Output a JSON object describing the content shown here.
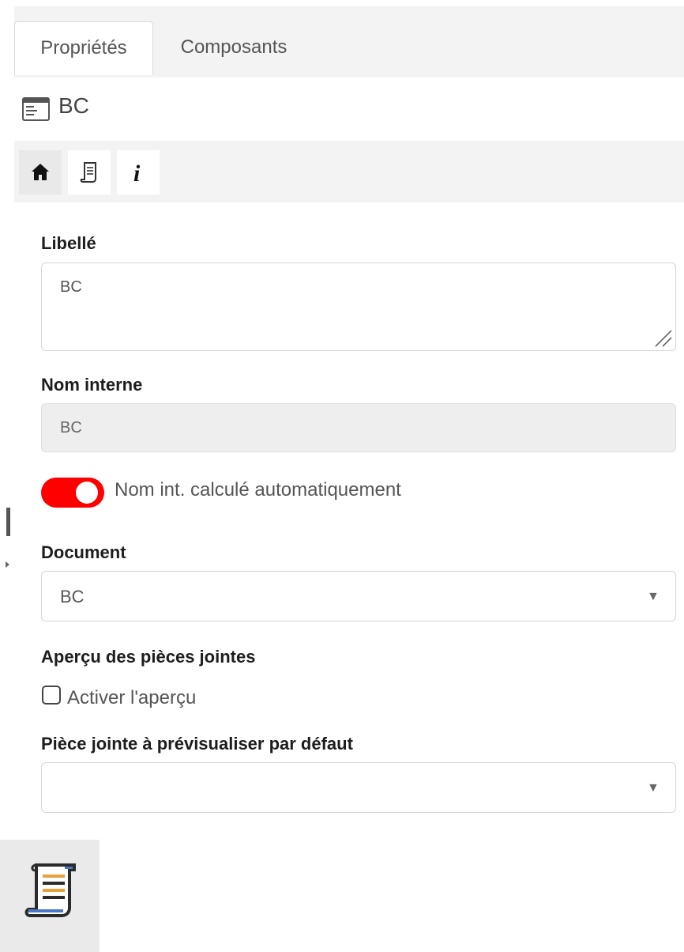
{
  "tabs": [
    {
      "label": "Propriétés",
      "active": true
    },
    {
      "label": "Composants",
      "active": false
    }
  ],
  "element": {
    "title": "BC",
    "icon": "form-window-icon"
  },
  "toolbar": {
    "buttons": [
      {
        "name": "home-icon",
        "active": true
      },
      {
        "name": "document-scroll-icon",
        "active": false
      },
      {
        "name": "info-icon",
        "active": false
      }
    ]
  },
  "form": {
    "libelle": {
      "label": "Libellé",
      "value": "BC"
    },
    "nom_interne": {
      "label": "Nom interne",
      "value": "BC"
    },
    "auto_name_toggle": {
      "label": "Nom int. calculé automatiquement",
      "checked": true,
      "color": "#ff0000"
    },
    "document": {
      "label": "Document",
      "value": "BC"
    },
    "apercu": {
      "label": "Aperçu des pièces jointes",
      "checkbox_label": "Activer l'aperçu",
      "checked": false
    },
    "piece_jointe": {
      "label": "Pièce jointe à prévisualiser par défaut",
      "value": ""
    }
  },
  "bottom_tile": {
    "icon": "document-scroll-icon"
  }
}
